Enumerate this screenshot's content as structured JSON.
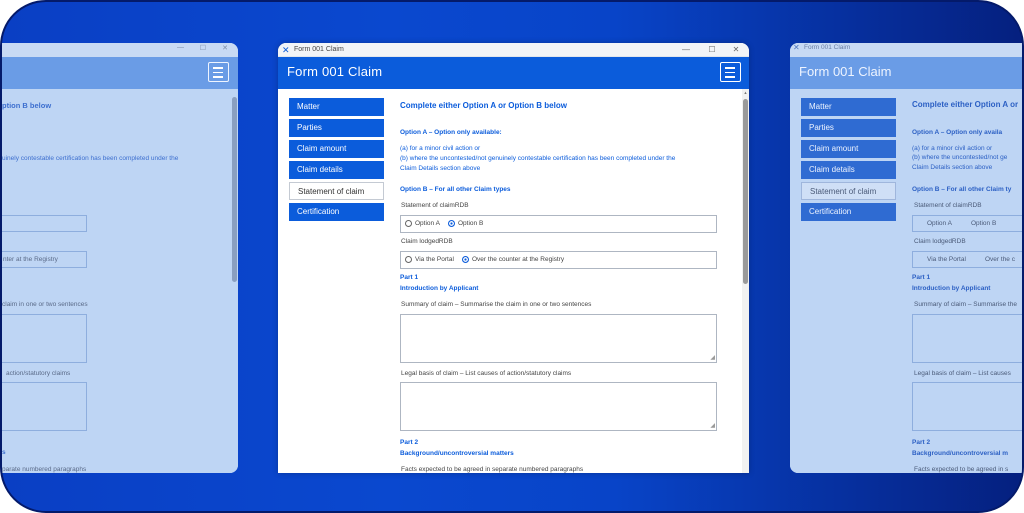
{
  "window": {
    "title": "Form 001 Claim",
    "app_title": "Form 001 Claim",
    "controls": {
      "minimize": "—",
      "maximize": "☐",
      "close": "✕"
    }
  },
  "sidebar": {
    "items": [
      {
        "label": "Matter"
      },
      {
        "label": "Parties"
      },
      {
        "label": "Claim amount"
      },
      {
        "label": "Claim details"
      },
      {
        "label": "Statement of claim"
      },
      {
        "label": "Certification"
      }
    ],
    "active": "Statement of claim"
  },
  "form": {
    "heading": "Complete either Option A or Option B below",
    "optionA_heading": "Option A – Option only available:",
    "optionA_line1": "(a) for a minor civil action or",
    "optionA_line2": "(b) where the uncontested/not genuinely contestable certification has been completed under the",
    "optionA_line3": "Claim Details section above",
    "optionB_heading": "Option B – For all other Claim types",
    "statement_label": "Statement of claimRDB",
    "statement_options": [
      "Option A",
      "Option B"
    ],
    "statement_selected": "Option B",
    "lodged_label": "Claim lodgedRDB",
    "lodged_options": [
      "Via the Portal",
      "Over the counter at the Registry"
    ],
    "lodged_selected": "Over the counter at the Registry",
    "part1": "Part 1",
    "part1_title": "Introduction by Applicant",
    "summary_label": "Summary of claim – Summarise the claim in one or two sentences",
    "summary_value": "",
    "legal_label": "Legal basis of claim – List causes of action/statutory claims",
    "legal_value": "",
    "part2": "Part 2",
    "part2_title": "Background/uncontroversial matters",
    "facts_label": "Facts expected to be agreed in separate numbered paragraphs"
  },
  "ghost_left": {
    "heading_fragment": "ption B below",
    "line_fragment": "uinely contestable certification has been completed under the",
    "radio_fragment": "nter at the Registry",
    "summary_fragment": "claim in one or two sentences",
    "legal_fragment": "action/statutory claims",
    "part2_fragment": "s",
    "facts_fragment": "parate numbered paragraphs"
  },
  "ghost_right": {
    "app_title": "Form 001 Claim",
    "heading_fragment": "Complete either Option A or",
    "optionA_heading": "Option A – Option only availa",
    "line1": "(a) for a minor civil action or",
    "line2": "(b) where the uncontested/not ge",
    "line3": "Claim Details section above",
    "optionB_heading": "Option B – For all other Claim ty",
    "statement_label": "Statement of claimRDB",
    "opt_a": "Option A",
    "opt_b": "Option B",
    "lodged_label": "Claim lodgedRDB",
    "via_portal": "Via the Portal",
    "over_counter": "Over the c",
    "part1": "Part 1",
    "part1_title": "Introduction by Applicant",
    "summary_fragment": "Summary of claim – Summarise the",
    "legal_fragment": "Legal basis of claim – List causes",
    "part2": "Part 2",
    "part2_title": "Background/uncontroversial m",
    "facts_fragment": "Facts expected to be agreed in s"
  },
  "colors": {
    "accent": "#0b5cdb",
    "background_gradient_start": "#0a3fc4",
    "background_gradient_end": "#05207f"
  }
}
